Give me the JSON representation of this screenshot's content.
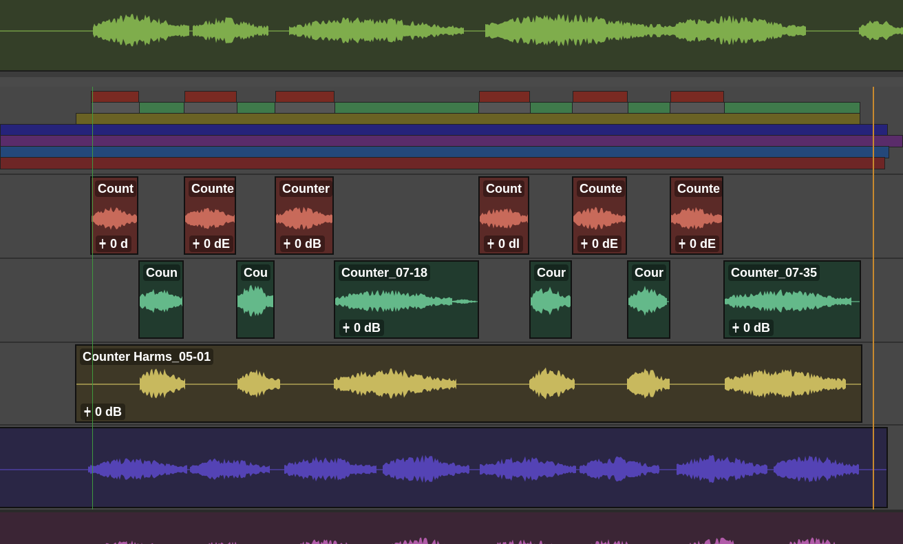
{
  "tracks": {
    "overview_top": {
      "color": "#7fad4c",
      "bg": "#343f28"
    },
    "red_lane": {
      "color": "#c86a5a",
      "bg": "#5b2a27",
      "clips": [
        {
          "name": "Count",
          "gain": "0 d"
        },
        {
          "name": "Counte",
          "gain": "0 dE"
        },
        {
          "name": "Counter",
          "gain": "0 dB"
        },
        {
          "name": "Count",
          "gain": "0 dl"
        },
        {
          "name": "Counte",
          "gain": "0 dE"
        },
        {
          "name": "Counte",
          "gain": "0 dE"
        }
      ]
    },
    "green_lane": {
      "color": "#64b98a",
      "bg": "#213b2e",
      "clips": [
        {
          "name": "Coun",
          "gain": ""
        },
        {
          "name": "Cou",
          "gain": ""
        },
        {
          "name": "Counter_07-18",
          "gain": "0 dB"
        },
        {
          "name": "Cour",
          "gain": ""
        },
        {
          "name": "Cour",
          "gain": ""
        },
        {
          "name": "Counter_07-35",
          "gain": "0 dB"
        }
      ]
    },
    "yellow_lane": {
      "color": "#c8b95e",
      "bg": "#3e3826",
      "clips": [
        {
          "name": "Counter Harms_05-01",
          "gain": "0 dB"
        }
      ]
    },
    "purple_lane": {
      "color": "#5443b5",
      "bg": "#2a2645"
    },
    "magenta_lane": {
      "color": "#b05aa8",
      "bg": "#3b2535"
    }
  },
  "overview_bars": {
    "red": "#7a2a22",
    "green": "#3f7a4b",
    "olive": "#6a6224",
    "navy": "#26237a",
    "violet": "#5a2c6a",
    "blue": "#24487a",
    "maroon": "#6e2626"
  },
  "markers": {
    "playhead_color": "#3e9a3e",
    "cursor_color": "#c98a2e"
  }
}
